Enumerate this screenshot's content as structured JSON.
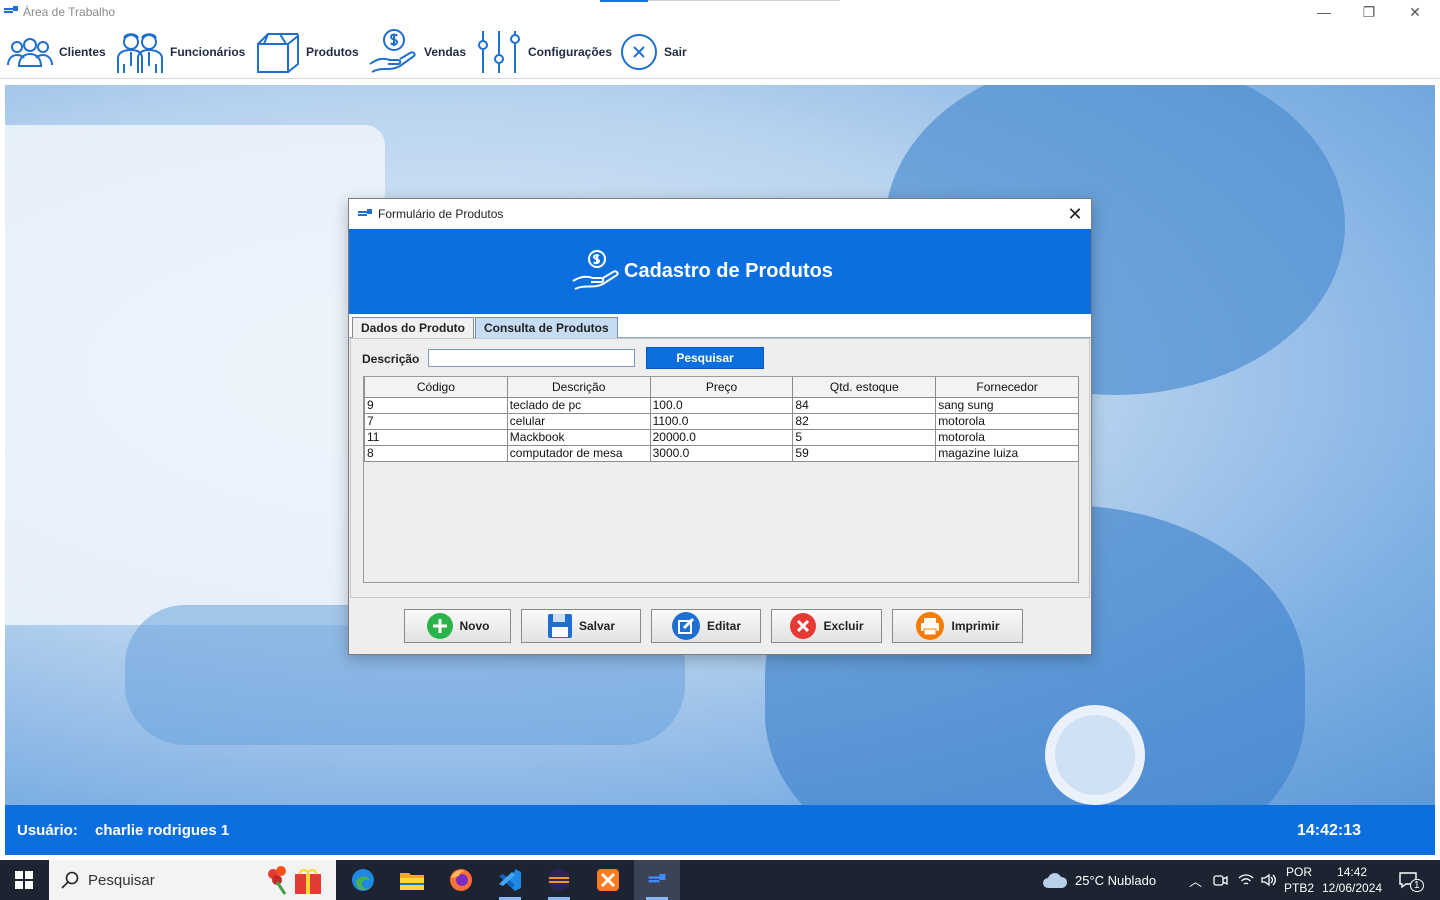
{
  "window": {
    "title": "Área de Trabalho",
    "minimize_glyph": "—",
    "maximize_glyph": "❐",
    "close_glyph": "✕"
  },
  "toolbar": {
    "items": [
      {
        "label": "Clientes",
        "icon": "people-icon"
      },
      {
        "label": "Funcionários",
        "icon": "employees-icon"
      },
      {
        "label": "Produtos",
        "icon": "box-icon"
      },
      {
        "label": "Vendas",
        "icon": "money-hand-icon"
      },
      {
        "label": "Configurações",
        "icon": "sliders-icon"
      },
      {
        "label": "Sair",
        "icon": "close-circle-icon"
      }
    ]
  },
  "status": {
    "user_label": "Usuário:",
    "user_name": "charlie rodrigues 1",
    "clock": "14:42:13"
  },
  "dialog": {
    "title": "Formulário de Produtos",
    "close_glyph": "✕",
    "header_title": "Cadastro de Produtos",
    "tabs": [
      {
        "label": "Dados do Produto",
        "active": false
      },
      {
        "label": "Consulta de Produtos",
        "active": true
      }
    ],
    "search": {
      "label": "Descrição",
      "value": "",
      "button": "Pesquisar"
    },
    "table": {
      "columns": [
        "Código",
        "Descrição",
        "Preço",
        "Qtd. estoque",
        "Fornecedor"
      ],
      "rows": [
        [
          "9",
          "teclado de pc",
          "100.0",
          "84",
          "sang sung"
        ],
        [
          "7",
          "celular",
          "1100.0",
          "82",
          "motorola"
        ],
        [
          "11",
          "Mackbook",
          "20000.0",
          "5",
          "motorola"
        ],
        [
          "8",
          "computador de mesa",
          "3000.0",
          "59",
          "magazine luiza"
        ]
      ]
    },
    "actions": [
      {
        "label": "Novo",
        "icon": "plus-icon",
        "color": "#2bb34a"
      },
      {
        "label": "Salvar",
        "icon": "floppy-icon",
        "color": "#1e6fd0"
      },
      {
        "label": "Editar",
        "icon": "edit-icon",
        "color": "#1e6fd0"
      },
      {
        "label": "Excluir",
        "icon": "x-icon",
        "color": "#e53935"
      },
      {
        "label": "Imprimir",
        "icon": "printer-icon",
        "color": "#f57c00"
      }
    ]
  },
  "taskbar": {
    "search_placeholder": "Pesquisar",
    "weather": "25°C  Nublado",
    "language": "POR",
    "layout": "PTB2",
    "time": "14:42",
    "date": "12/06/2024",
    "notifications": "1"
  },
  "colors": {
    "accent": "#0b6fe0",
    "toolbar_icon": "#1e6fd0"
  }
}
